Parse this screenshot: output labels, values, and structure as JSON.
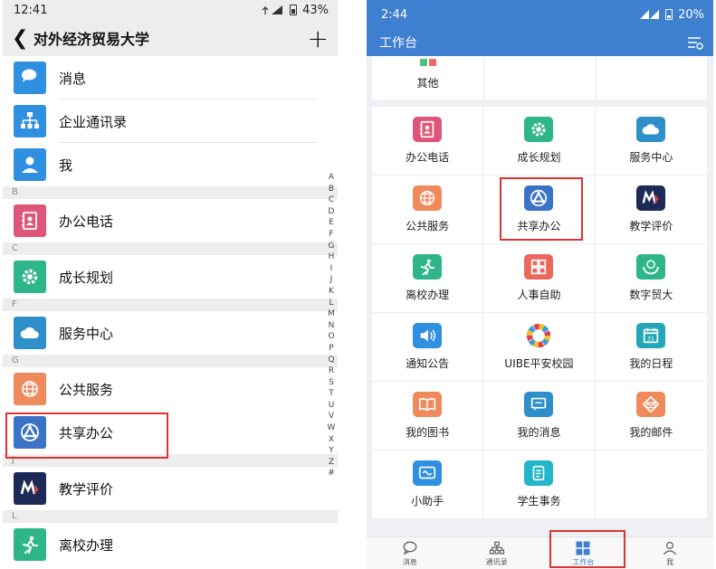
{
  "left": {
    "status": {
      "time": "12:41",
      "battery": "43%"
    },
    "title": "对外经济贸易大学",
    "rows_top": [
      {
        "label": "消息",
        "icon": "chat-bubble-icon",
        "color": "#2f8fe0"
      },
      {
        "label": "企业通讯录",
        "icon": "org-chart-icon",
        "color": "#2f8fe0"
      },
      {
        "label": "我",
        "icon": "person-icon",
        "color": "#2f8fe0"
      }
    ],
    "sections": [
      {
        "letter": "B",
        "label": "办公电话",
        "icon": "address-book-icon",
        "color": "#e0567a"
      },
      {
        "letter": "C",
        "label": "成长规划",
        "icon": "gear-icon",
        "color": "#2fb58a"
      },
      {
        "letter": "F",
        "label": "服务中心",
        "icon": "cloud-icon",
        "color": "#2f8fc8"
      },
      {
        "letter": "G",
        "label": "公共服务",
        "icon": "globe-icon",
        "color": "#ef8a5c"
      },
      {
        "letter": "",
        "label": "共享办公",
        "icon": "share-triangle-icon",
        "color": "#3b73c7"
      },
      {
        "letter": "J",
        "label": "教学评价",
        "icon": "my-logo-icon",
        "color": "#1d2a55"
      },
      {
        "letter": "L",
        "label": "离校办理",
        "icon": "running-man-icon",
        "color": "#2fb58a"
      }
    ],
    "alphabet": [
      "A",
      "B",
      "C",
      "D",
      "E",
      "F",
      "G",
      "H",
      "I",
      "J",
      "K",
      "L",
      "M",
      "N",
      "O",
      "P",
      "Q",
      "R",
      "S",
      "T",
      "U",
      "V",
      "W",
      "X",
      "Y",
      "Z",
      "#"
    ]
  },
  "right": {
    "status": {
      "time": "2:44",
      "battery": "20%"
    },
    "title": "工作台",
    "top_item": "其他",
    "apps": [
      {
        "label": "办公电话",
        "icon": "address-book-icon",
        "color": "#e0567a"
      },
      {
        "label": "成长规划",
        "icon": "gear-icon",
        "color": "#2fb58a"
      },
      {
        "label": "服务中心",
        "icon": "cloud-icon",
        "color": "#2f8fc8"
      },
      {
        "label": "公共服务",
        "icon": "globe-icon",
        "color": "#ef8a5c"
      },
      {
        "label": "共享办公",
        "icon": "share-triangle-icon",
        "color": "#3b73c7"
      },
      {
        "label": "教学评价",
        "icon": "my-logo-icon",
        "color": "#1d2a55"
      },
      {
        "label": "离校办理",
        "icon": "running-man-icon",
        "color": "#2fb58a"
      },
      {
        "label": "人事自助",
        "icon": "grid-app-icon",
        "color": "#e9695e"
      },
      {
        "label": "数字贸大",
        "icon": "hands-globe-icon",
        "color": "#2fb58a"
      },
      {
        "label": "通知公告",
        "icon": "speaker-icon",
        "color": "#2f8fe0"
      },
      {
        "label": "UIBE平安校园",
        "icon": "colorful-ring-icon",
        "color": "#ffffff"
      },
      {
        "label": "我的日程",
        "icon": "calendar-icon",
        "color": "#23a7b8"
      },
      {
        "label": "我的图书",
        "icon": "book-icon",
        "color": "#ef8a5c"
      },
      {
        "label": "我的消息",
        "icon": "message-icon",
        "color": "#2f8fc8"
      },
      {
        "label": "我的邮件",
        "icon": "mail-icon",
        "color": "#ef8a5c"
      },
      {
        "label": "小助手",
        "icon": "assistant-icon",
        "color": "#2f8fe0"
      },
      {
        "label": "学生事务",
        "icon": "student-affairs-icon",
        "color": "#23b5c8"
      }
    ],
    "tabs": [
      {
        "label": "消息",
        "icon": "chat-bubble-icon"
      },
      {
        "label": "通讯录",
        "icon": "org-chart-icon"
      },
      {
        "label": "工作台",
        "icon": "workbench-grid-icon",
        "active": true
      },
      {
        "label": "我",
        "icon": "person-icon"
      }
    ]
  }
}
